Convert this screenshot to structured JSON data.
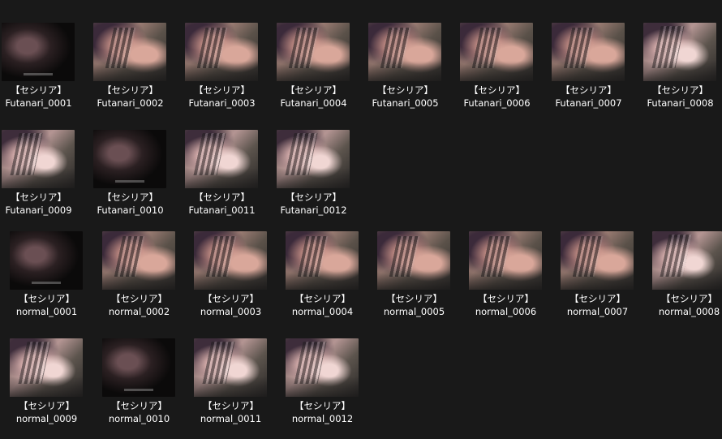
{
  "files": [
    {
      "line1": "【セシリア】",
      "line2": "Futanari_0001",
      "thumb": "dark"
    },
    {
      "line1": "【セシリア】",
      "line2": "Futanari_0002",
      "thumb": "scene"
    },
    {
      "line1": "【セシリア】",
      "line2": "Futanari_0003",
      "thumb": "scene"
    },
    {
      "line1": "【セシリア】",
      "line2": "Futanari_0004",
      "thumb": "scene"
    },
    {
      "line1": "【セシリア】",
      "line2": "Futanari_0005",
      "thumb": "scene"
    },
    {
      "line1": "【セシリア】",
      "line2": "Futanari_0006",
      "thumb": "scene"
    },
    {
      "line1": "【セシリア】",
      "line2": "Futanari_0007",
      "thumb": "scene"
    },
    {
      "line1": "【セシリア】",
      "line2": "Futanari_0008",
      "thumb": "wet"
    },
    {
      "line1": "【セシリア】",
      "line2": "Futanari_0009",
      "thumb": "wet"
    },
    {
      "line1": "【セシリア】",
      "line2": "Futanari_0010",
      "thumb": "dark"
    },
    {
      "line1": "【セシリア】",
      "line2": "Futanari_0011",
      "thumb": "wet"
    },
    {
      "line1": "【セシリア】",
      "line2": "Futanari_0012",
      "thumb": "wet"
    },
    {
      "line1": "【セシリア】",
      "line2": "normal_0001",
      "thumb": "dark"
    },
    {
      "line1": "【セシリア】",
      "line2": "normal_0002",
      "thumb": "scene"
    },
    {
      "line1": "【セシリア】",
      "line2": "normal_0003",
      "thumb": "scene"
    },
    {
      "line1": "【セシリア】",
      "line2": "normal_0004",
      "thumb": "scene"
    },
    {
      "line1": "【セシリア】",
      "line2": "normal_0005",
      "thumb": "scene"
    },
    {
      "line1": "【セシリア】",
      "line2": "normal_0006",
      "thumb": "scene"
    },
    {
      "line1": "【セシリア】",
      "line2": "normal_0007",
      "thumb": "scene"
    },
    {
      "line1": "【セシリア】",
      "line2": "normal_0008",
      "thumb": "wet"
    },
    {
      "line1": "【セシリア】",
      "line2": "normal_0009",
      "thumb": "wet"
    },
    {
      "line1": "【セシリア】",
      "line2": "normal_0010",
      "thumb": "dark"
    },
    {
      "line1": "【セシリア】",
      "line2": "normal_0011",
      "thumb": "wet"
    },
    {
      "line1": "【セシリア】",
      "line2": "normal_0012",
      "thumb": "wet"
    }
  ]
}
